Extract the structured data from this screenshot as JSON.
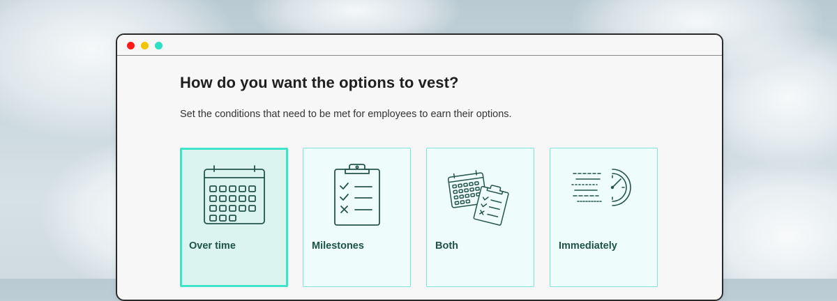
{
  "window": {
    "controls": [
      {
        "name": "close",
        "color": "#ff1a1a"
      },
      {
        "name": "minimize",
        "color": "#f5c400"
      },
      {
        "name": "maximize",
        "color": "#2ee0c4"
      }
    ]
  },
  "page": {
    "heading": "How do you want the options to vest?",
    "subtitle": "Set the conditions that need to be met for employees to earn their options."
  },
  "options": [
    {
      "label": "Over time",
      "icon": "calendar-icon",
      "selected": true
    },
    {
      "label": "Milestones",
      "icon": "checklist-clipboard-icon",
      "selected": false
    },
    {
      "label": "Both",
      "icon": "calendar-and-clipboard-icon",
      "selected": false
    },
    {
      "label": "Immediately",
      "icon": "fast-clock-icon",
      "selected": false
    }
  ],
  "colors": {
    "accent": "#3ee3c8",
    "card_border": "#7fe3d6",
    "card_bg": "#eefcfb",
    "selected_bg": "#dbf4f0",
    "icon_stroke": "#24544b",
    "label": "#1e5248"
  }
}
